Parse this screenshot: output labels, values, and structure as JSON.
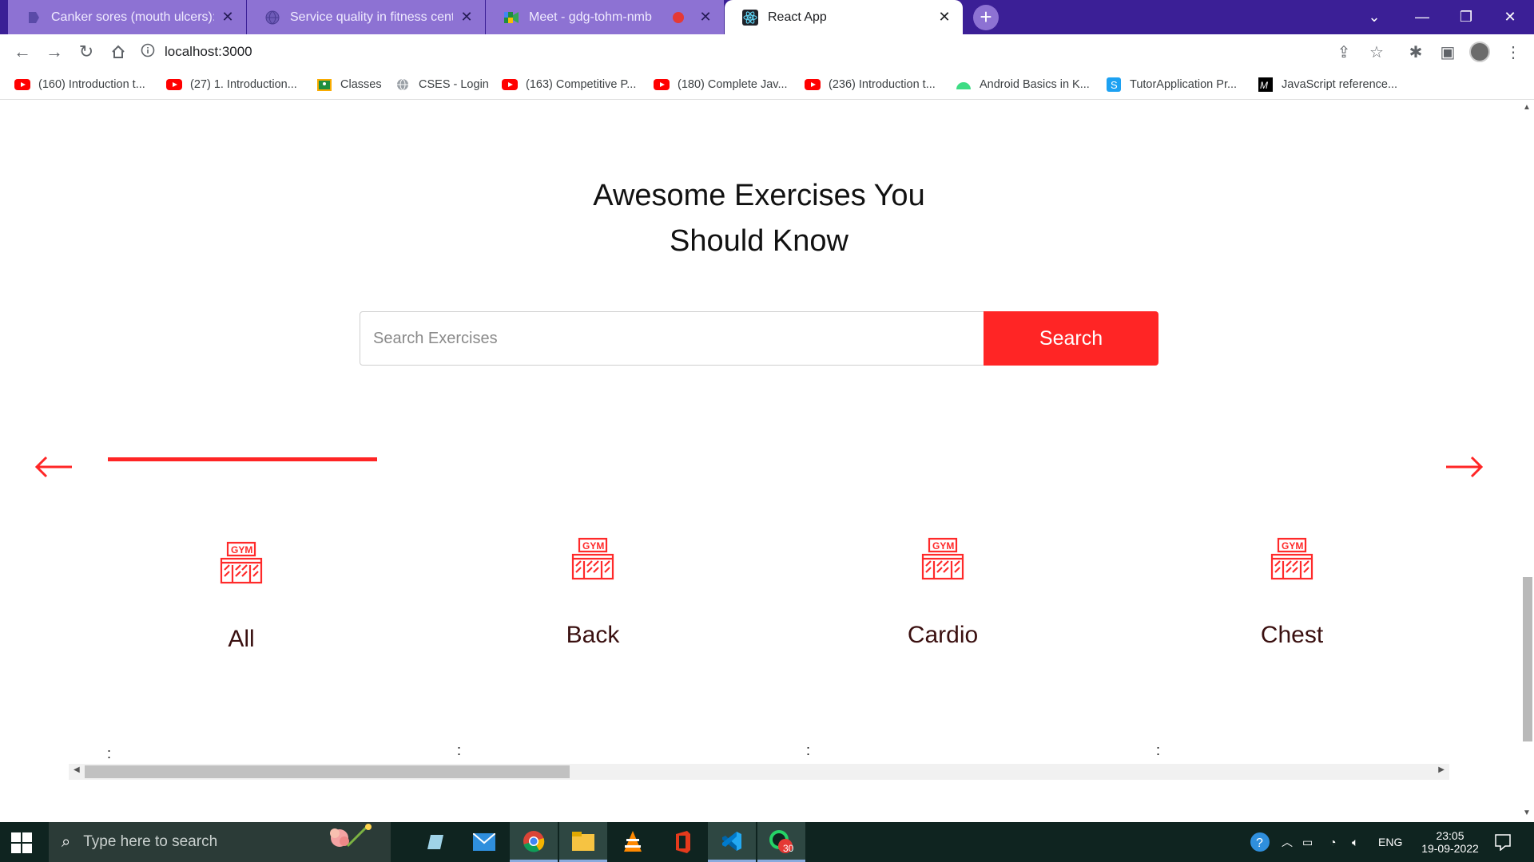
{
  "browser": {
    "tabs": [
      {
        "title": "Canker sores (mouth ulcers): Wh",
        "state": "inactive",
        "icon": "doc-icon"
      },
      {
        "title": "Service quality in fitness centres:",
        "state": "inactive",
        "icon": "globe-icon"
      },
      {
        "title": "Meet - gdg-tohm-nmb",
        "state": "inactive",
        "icon": "meet-icon",
        "recording": true
      },
      {
        "title": "React App",
        "state": "active",
        "icon": "react-icon"
      }
    ],
    "address": "localhost:3000",
    "bookmarks": [
      {
        "label": "(160) Introduction t...",
        "icon": "youtube-icon"
      },
      {
        "label": "(27) 1. Introduction...",
        "icon": "youtube-icon"
      },
      {
        "label": "Classes",
        "icon": "classroom-icon"
      },
      {
        "label": "CSES - Login",
        "icon": "globe-icon"
      },
      {
        "label": "(163) Competitive P...",
        "icon": "youtube-icon"
      },
      {
        "label": "(180) Complete Jav...",
        "icon": "youtube-icon"
      },
      {
        "label": "(236) Introduction t...",
        "icon": "youtube-icon"
      },
      {
        "label": "Android Basics in K...",
        "icon": "android-icon"
      },
      {
        "label": "TutorApplication Pr...",
        "icon": "tutor-icon"
      },
      {
        "label": "JavaScript reference...",
        "icon": "mdn-icon"
      }
    ]
  },
  "page": {
    "heading_line1": "Awesome Exercises You",
    "heading_line2": "Should Know",
    "search_placeholder": "Search Exercises",
    "search_button": "Search",
    "categories": [
      "All",
      "Back",
      "Cardio",
      "Chest"
    ],
    "card_footnote": ":",
    "accent_color": "#ff2525"
  },
  "taskbar": {
    "search_placeholder": "Type here to search",
    "whatsapp_badge": "30",
    "language": "ENG",
    "time": "23:05",
    "date": "19-09-2022"
  }
}
